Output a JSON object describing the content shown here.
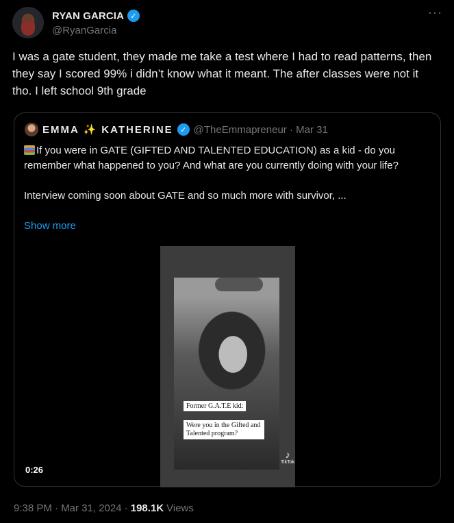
{
  "author": {
    "name": "RYAN GARCIA",
    "handle": "@RyanGarcia"
  },
  "tweet": {
    "text": "I was a gate student, they made me take a test where I had to read patterns, then they say I scored 99% i didn’t know what it meant. The after classes were not it tho. I left school 9th grade"
  },
  "quote": {
    "author_name": "EMMA ✨ KATHERINE",
    "meta": "@TheEmmapreneur · Mar 31",
    "text_1": "If you were in GATE (GIFTED AND TALENTED EDUCATION) as a kid - do you remember what happened to you? And what are you currently doing with your life?",
    "text_2": "Interview coming soon about GATE and so much more with survivor, ...",
    "show_more": "Show more",
    "video": {
      "caption_1": "Former G.A.T.E kid:",
      "caption_2": "Were you in the Gifted and Talented program?",
      "tiktok_label": "TikTok",
      "duration": "0:26"
    }
  },
  "footer": {
    "timestamp": "9:38 PM · Mar 31, 2024 ·",
    "views_count": "198.1K",
    "views_label": "Views"
  },
  "icons": {
    "verified": "verified-badge-icon",
    "more": "more-icon",
    "books": "books-emoji-icon"
  },
  "colors": {
    "background": "#000000",
    "accent": "#1d9bf0",
    "secondary_text": "#71767b"
  }
}
